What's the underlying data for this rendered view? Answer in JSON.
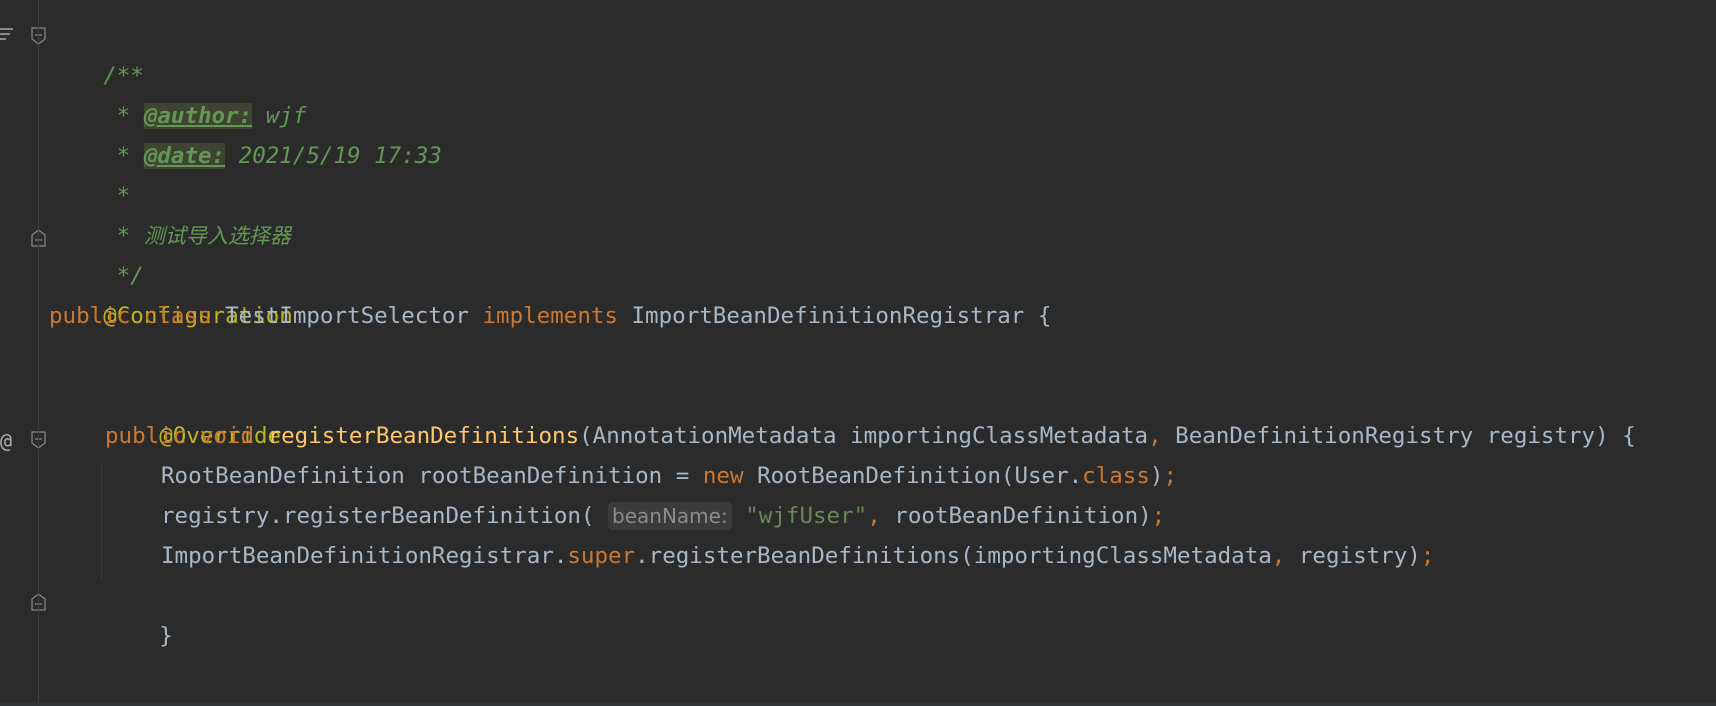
{
  "editor": {
    "language": "java",
    "colors": {
      "background": "#2b2b2b",
      "comment": "#629755",
      "keyword": "#cc7832",
      "annotation": "#bbb529",
      "method": "#ffc66d",
      "string": "#6a8759",
      "default": "#a9b7c6"
    },
    "gutter": {
      "override_marker": "@"
    },
    "lines": {
      "l1": {
        "open": "/**"
      },
      "l2": {
        "star": " * ",
        "tag": "@author:",
        "text": " wjf"
      },
      "l3": {
        "star": " * ",
        "tag": "@date:",
        "text": " 2021/5/19 17:33"
      },
      "l4": {
        "star": " *"
      },
      "l5": {
        "star": " * ",
        "text": "测试导入选择器"
      },
      "l6": {
        "close": " */"
      },
      "l7": {
        "annotation": "@Configuration"
      },
      "l8": {
        "kw1": "public",
        "kw2": "class",
        "class_name": "TestImportSelector",
        "kw3": "implements",
        "interface_name": "ImportBeanDefinitionRegistrar",
        "brace": "{"
      },
      "l10": {
        "annotation": "@Override"
      },
      "l11": {
        "kw1": "public",
        "kw2": "void",
        "method": "registerBeanDefinitions",
        "p_open": "(",
        "p1_type": "AnnotationMetadata",
        "p1_name": "importingClassMetadata",
        "comma": ",",
        "p2_type": "BeanDefinitionRegistry",
        "p2_name": "registry",
        "p_close": ")",
        "brace": "{"
      },
      "l12": {
        "type": "RootBeanDefinition",
        "var": "rootBeanDefinition",
        "eq": "=",
        "kw_new": "new",
        "ctor": "RootBeanDefinition(User.",
        "kw_class": "class",
        "close": ")",
        "semi": ";"
      },
      "l13": {
        "call": "registry.registerBeanDefinition(",
        "hint": "beanName:",
        "string": "\"wjfUser\"",
        "comma": ",",
        "arg": " rootBeanDefinition)",
        "semi": ";"
      },
      "l14": {
        "target": "ImportBeanDefinitionRegistrar.",
        "kw_super": "super",
        "call": ".registerBeanDefinitions(importingClassMetadata",
        "comma": ",",
        "arg": " registry)",
        "semi": ";"
      },
      "l15": {
        "brace": "}"
      },
      "l17": {
        "brace": "}"
      }
    }
  }
}
